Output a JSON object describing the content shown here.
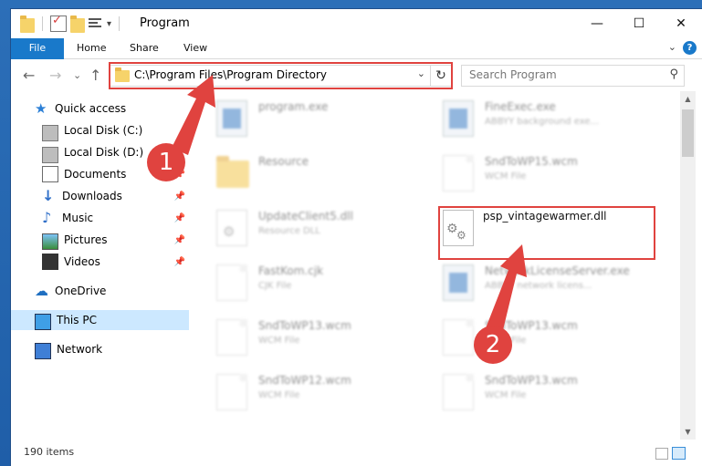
{
  "window": {
    "title": "Program",
    "controls": {
      "minimize": "—",
      "maximize": "☐",
      "close": "✕"
    }
  },
  "ribbon": {
    "tabs": [
      "File",
      "Home",
      "Share",
      "View"
    ],
    "chevron": "⌄",
    "help": "?"
  },
  "navigation": {
    "back": "←",
    "forward": "→",
    "recent": "⌄",
    "up": "↑",
    "address": "C:\\Program Files\\Program Directory",
    "address_dropdown": "⌄",
    "refresh": "↻",
    "search_placeholder": "Search Program",
    "search_icon": "⚲"
  },
  "sidebar": {
    "items": [
      {
        "label": "Quick access",
        "icon": "star-icon",
        "pinned": false
      },
      {
        "label": "Local Disk (C:)",
        "icon": "disk-icon",
        "pinned": false
      },
      {
        "label": "Local Disk (D:)",
        "icon": "disk-icon",
        "pinned": false
      },
      {
        "label": "Documents",
        "icon": "documents-icon",
        "pinned": true
      },
      {
        "label": "Downloads",
        "icon": "download-icon",
        "pinned": true
      },
      {
        "label": "Music",
        "icon": "music-icon",
        "pinned": true
      },
      {
        "label": "Pictures",
        "icon": "pictures-icon",
        "pinned": true
      },
      {
        "label": "Videos",
        "icon": "videos-icon",
        "pinned": true
      },
      {
        "label": "OneDrive",
        "icon": "cloud-icon",
        "pinned": false
      },
      {
        "label": "This PC",
        "icon": "pc-icon",
        "pinned": false,
        "selected": true
      },
      {
        "label": "Network",
        "icon": "network-icon",
        "pinned": false
      }
    ],
    "pin_glyph": "📌"
  },
  "files": [
    {
      "name": "program.exe",
      "desc": "",
      "icon": "app",
      "blurred": true
    },
    {
      "name": "FineExec.exe",
      "desc": "ABBYY background exe...",
      "icon": "app",
      "blurred": true
    },
    {
      "name": "Resource",
      "desc": "",
      "icon": "folder",
      "blurred": true
    },
    {
      "name": "SndToWP15.wcm",
      "desc": "WCM File",
      "icon": "doc",
      "blurred": true
    },
    {
      "name": "UpdateClient5.dll",
      "desc": "Resource DLL",
      "icon": "gear",
      "blurred": true
    },
    {
      "name": "psp_vintagewarmer.dll",
      "desc": "",
      "icon": "gear",
      "blurred": false
    },
    {
      "name": "FastKom.cjk",
      "desc": "CJK File",
      "icon": "doc",
      "blurred": true
    },
    {
      "name": "NetworkLicenseServer.exe",
      "desc": "ABBYY network licens...",
      "icon": "app",
      "blurred": true
    },
    {
      "name": "SndToWP13.wcm",
      "desc": "WCM File",
      "icon": "doc",
      "blurred": true
    },
    {
      "name": "SndToWP13.wcm",
      "desc": "WCM File",
      "icon": "doc",
      "blurred": true
    },
    {
      "name": "SndToWP12.wcm",
      "desc": "WCM File",
      "icon": "doc",
      "blurred": true
    },
    {
      "name": "SndToWP13.wcm",
      "desc": "WCM File",
      "icon": "doc",
      "blurred": true
    }
  ],
  "status": {
    "items_count": "190 items"
  },
  "annotations": {
    "badge1": "1",
    "badge2": "2",
    "accent": "#e0433f"
  }
}
